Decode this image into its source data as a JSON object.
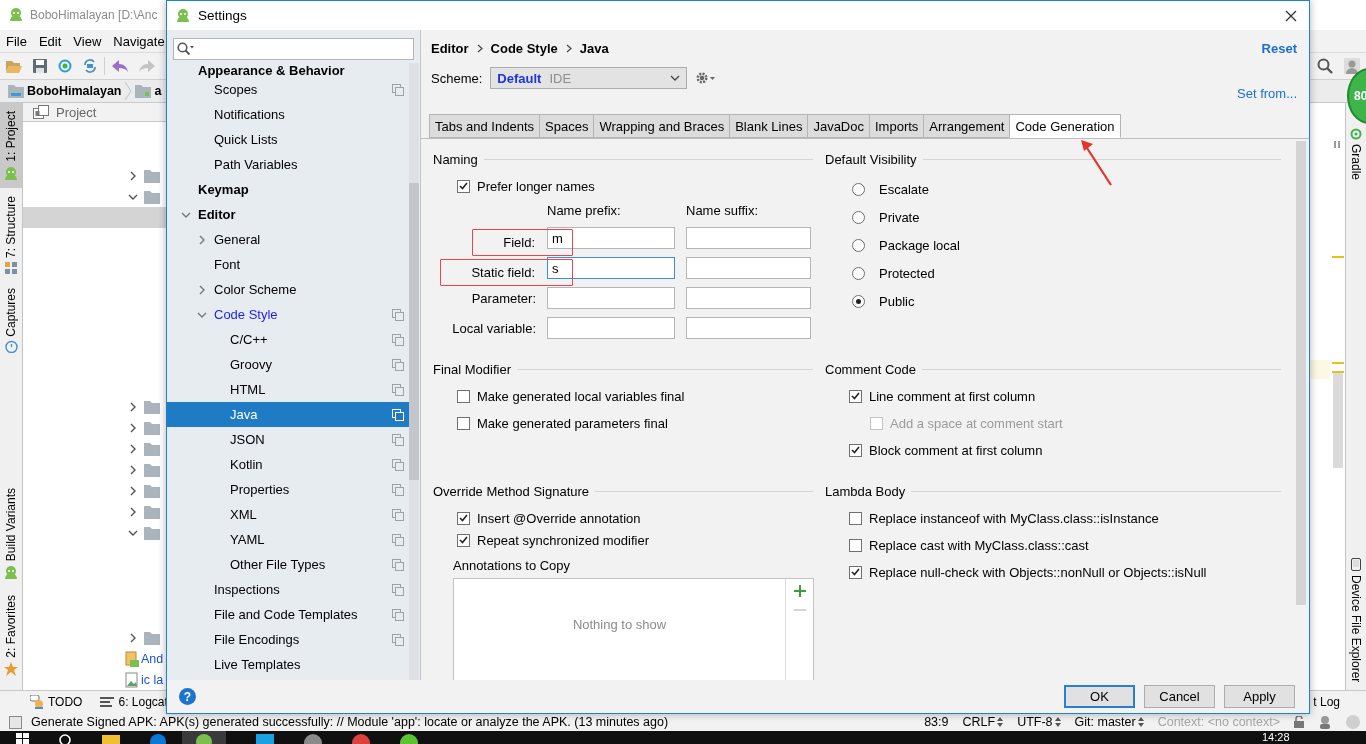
{
  "ide": {
    "title": "BoboHimalayan [D:\\Anc",
    "menu": [
      "File",
      "Edit",
      "View",
      "Navigate"
    ],
    "breadcrumb": [
      "BoboHimalayan",
      "a"
    ],
    "left_tools": [
      {
        "label": "1: Project",
        "selected": true
      },
      {
        "label": "7: Structure",
        "selected": false
      },
      {
        "label": "Captures",
        "selected": false
      },
      {
        "label": "Build Variants",
        "selected": false
      },
      {
        "label": "2: Favorites",
        "selected": false
      }
    ],
    "project": {
      "title": "Project",
      "rows": [
        {
          "kind": "folder",
          "expanded": false,
          "selected": false
        },
        {
          "kind": "folder",
          "expanded": true,
          "selected": false
        },
        {
          "kind": "file",
          "selected": true
        },
        {
          "kind": "folder",
          "expanded": false,
          "selected": false
        },
        {
          "kind": "folder",
          "expanded": false,
          "selected": false
        },
        {
          "kind": "folder",
          "expanded": false,
          "selected": false
        },
        {
          "kind": "folder",
          "expanded": false,
          "selected": false
        },
        {
          "kind": "folder",
          "expanded": false,
          "selected": false
        },
        {
          "kind": "folder",
          "expanded": false,
          "selected": false
        },
        {
          "kind": "folder",
          "expanded": true,
          "selected": false
        },
        {
          "kind": "folder",
          "expanded": false,
          "selected": false
        },
        {
          "kind": "manifest",
          "label": "And",
          "selected": false
        },
        {
          "kind": "image",
          "label": "ic la",
          "selected": false
        }
      ]
    },
    "right_tools": [
      {
        "label": "Gradle"
      },
      {
        "label": "Device File Explorer"
      }
    ],
    "memory_badge": "80",
    "bottom_tools": [
      {
        "label": "TODO"
      },
      {
        "label": "6: Logcat"
      },
      {
        "label": "t Log"
      }
    ],
    "status": {
      "message": "Generate Signed APK: APK(s) generated successfully: // Module 'app': locate or analyze the APK. (13 minutes ago)",
      "items": [
        {
          "label": "83:9",
          "switch": false,
          "disabled": false
        },
        {
          "label": "CRLF",
          "switch": true,
          "disabled": false
        },
        {
          "label": "UTF-8",
          "switch": true,
          "disabled": false
        },
        {
          "label": "Git: master",
          "switch": true,
          "disabled": false
        },
        {
          "label": "Context: <no context>",
          "switch": false,
          "disabled": true
        }
      ]
    },
    "clock": "14:28"
  },
  "settings": {
    "title": "Settings",
    "sidebar": {
      "pinned": {
        "label": "Appearance & Behavior",
        "selected": false,
        "modified": false,
        "scoped": false,
        "children": [
          {
            "label": "Scopes",
            "selected": false,
            "modified": false,
            "scoped": true
          },
          {
            "label": "Notifications",
            "selected": false,
            "modified": false,
            "scoped": false
          },
          {
            "label": "Quick Lists",
            "selected": false,
            "modified": false,
            "scoped": false
          },
          {
            "label": "Path Variables",
            "selected": false,
            "modified": false,
            "scoped": false
          }
        ]
      },
      "items": [
        {
          "label": "Keymap",
          "selected": false,
          "modified": false,
          "scoped": false
        },
        {
          "label": "Editor",
          "expanded": true,
          "selected": false,
          "modified": false,
          "scoped": false,
          "children": [
            {
              "label": "General",
              "expanded": false,
              "selected": false,
              "modified": false,
              "scoped": false
            },
            {
              "label": "Font",
              "selected": false,
              "modified": false,
              "scoped": false
            },
            {
              "label": "Color Scheme",
              "expanded": false,
              "selected": false,
              "modified": false,
              "scoped": false
            },
            {
              "label": "Code Style",
              "expanded": true,
              "selected": false,
              "modified": true,
              "scoped": true,
              "children": [
                {
                  "label": "C/C++",
                  "selected": false,
                  "modified": false,
                  "scoped": true
                },
                {
                  "label": "Groovy",
                  "selected": false,
                  "modified": false,
                  "scoped": true
                },
                {
                  "label": "HTML",
                  "selected": false,
                  "modified": false,
                  "scoped": true
                },
                {
                  "label": "Java",
                  "selected": true,
                  "modified": false,
                  "scoped": true
                },
                {
                  "label": "JSON",
                  "selected": false,
                  "modified": false,
                  "scoped": true
                },
                {
                  "label": "Kotlin",
                  "selected": false,
                  "modified": false,
                  "scoped": true
                },
                {
                  "label": "Properties",
                  "selected": false,
                  "modified": false,
                  "scoped": true
                },
                {
                  "label": "XML",
                  "selected": false,
                  "modified": false,
                  "scoped": true
                },
                {
                  "label": "YAML",
                  "selected": false,
                  "modified": false,
                  "scoped": true
                },
                {
                  "label": "Other File Types",
                  "selected": false,
                  "modified": false,
                  "scoped": true
                }
              ]
            },
            {
              "label": "Inspections",
              "selected": false,
              "modified": false,
              "scoped": true
            },
            {
              "label": "File and Code Templates",
              "selected": false,
              "modified": false,
              "scoped": true
            },
            {
              "label": "File Encodings",
              "selected": false,
              "modified": false,
              "scoped": true
            },
            {
              "label": "Live Templates",
              "selected": false,
              "modified": false,
              "scoped": false
            }
          ]
        }
      ]
    },
    "breadcrumb": [
      "Editor",
      "Code Style",
      "Java"
    ],
    "reset": "Reset",
    "scheme": {
      "label": "Scheme:",
      "value": "Default",
      "scope": "IDE"
    },
    "set_from": "Set from...",
    "tabs": [
      {
        "label": "Tabs and Indents",
        "selected": false
      },
      {
        "label": "Spaces",
        "selected": false
      },
      {
        "label": "Wrapping and Braces",
        "selected": false
      },
      {
        "label": "Blank Lines",
        "selected": false
      },
      {
        "label": "JavaDoc",
        "selected": false
      },
      {
        "label": "Imports",
        "selected": false
      },
      {
        "label": "Arrangement",
        "selected": false
      },
      {
        "label": "Code Generation",
        "selected": true
      }
    ],
    "naming": {
      "title": "Naming",
      "prefer_longer": {
        "label": "Prefer longer names",
        "checked": true
      },
      "columns": [
        "Name prefix:",
        "Name suffix:"
      ],
      "rows": [
        {
          "label": "Field:",
          "prefix": "m",
          "annotated": true,
          "focused": false
        },
        {
          "label": "Static field:",
          "prefix": "s",
          "annotated": true,
          "focused": true
        },
        {
          "label": "Parameter:",
          "annotated": false,
          "focused": false
        },
        {
          "label": "Local variable:",
          "annotated": false,
          "focused": false
        }
      ]
    },
    "default_visibility": {
      "title": "Default Visibility",
      "options": [
        {
          "label": "Escalate",
          "selected": false
        },
        {
          "label": "Private",
          "selected": false
        },
        {
          "label": "Package local",
          "selected": false
        },
        {
          "label": "Protected",
          "selected": false
        },
        {
          "label": "Public",
          "selected": true
        }
      ]
    },
    "final_modifier": {
      "title": "Final Modifier",
      "options": [
        {
          "label": "Make generated local variables final",
          "checked": false
        },
        {
          "label": "Make generated parameters final",
          "checked": false
        }
      ]
    },
    "comment_code": {
      "title": "Comment Code",
      "options": [
        {
          "label": "Line comment at first column",
          "checked": true,
          "disabled": false,
          "children": [
            {
              "label": "Add a space at comment start",
              "checked": false,
              "disabled": true
            }
          ]
        },
        {
          "label": "Block comment at first column",
          "checked": true,
          "disabled": false
        }
      ]
    },
    "override": {
      "title": "Override Method Signature",
      "options": [
        {
          "label": "Insert @Override annotation",
          "checked": true
        },
        {
          "label": "Repeat synchronized modifier",
          "checked": true
        }
      ],
      "annotations": {
        "title": "Annotations to Copy",
        "empty_text": "Nothing to show",
        "add_enabled": true,
        "remove_enabled": false
      }
    },
    "lambda": {
      "title": "Lambda Body",
      "options": [
        {
          "label": "Replace instanceof with MyClass.class::isInstance",
          "checked": false
        },
        {
          "label": "Replace cast with MyClass.class::cast",
          "checked": false
        },
        {
          "label": "Replace null-check with Objects::nonNull or Objects::isNull",
          "checked": true
        }
      ]
    },
    "help_button": "?",
    "buttons": [
      {
        "label": "OK",
        "default": true
      },
      {
        "label": "Cancel",
        "default": false
      },
      {
        "label": "Apply",
        "default": false
      }
    ]
  }
}
